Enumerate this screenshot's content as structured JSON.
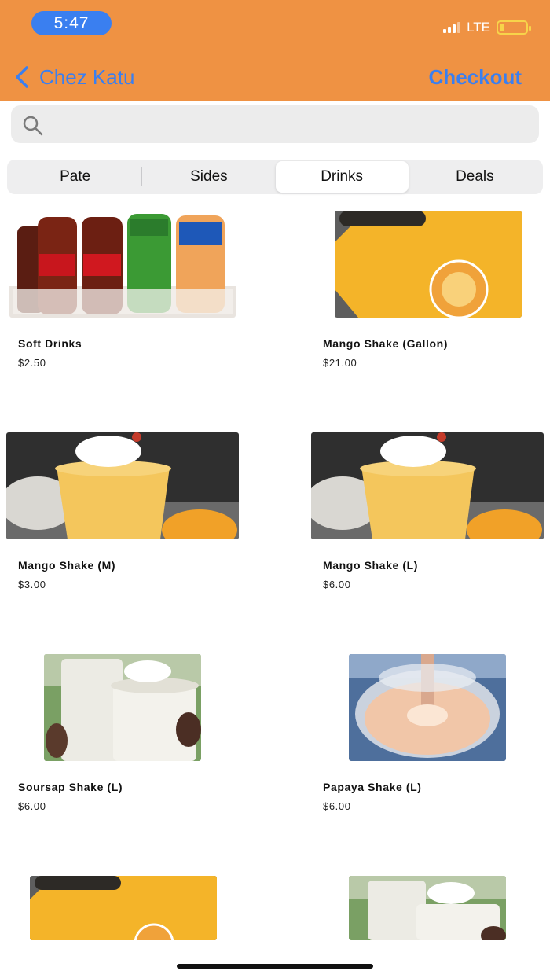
{
  "status_bar": {
    "time": "5:47",
    "network": "LTE"
  },
  "nav": {
    "back_label": "Chez Katu",
    "checkout_label": "Checkout"
  },
  "search": {
    "placeholder": ""
  },
  "tabs": [
    {
      "label": "Pate",
      "active": false
    },
    {
      "label": "Sides",
      "active": false
    },
    {
      "label": "Drinks",
      "active": true
    },
    {
      "label": "Deals",
      "active": false
    }
  ],
  "products": [
    {
      "name": "Soft Drinks",
      "price": "$2.50",
      "image": "soft-drink-bottles"
    },
    {
      "name": "Mango Shake (Gallon)",
      "price": "$21.00",
      "image": "mango-shake-gallon-bag"
    },
    {
      "name": "Mango Shake (M)",
      "price": "$3.00",
      "image": "mango-shake-cup"
    },
    {
      "name": "Mango Shake (L)",
      "price": "$6.00",
      "image": "mango-shake-cup"
    },
    {
      "name": "Soursap Shake (L)",
      "price": "$6.00",
      "image": "soursop-shake-cups"
    },
    {
      "name": "Papaya Shake (L)",
      "price": "$6.00",
      "image": "papaya-shake-cup"
    },
    {
      "name": "",
      "price": "",
      "image": "mango-shake-gallon-bag"
    },
    {
      "name": "",
      "price": "",
      "image": "soursop-shake-cups"
    }
  ],
  "colors": {
    "header": "#ef9243",
    "accent": "#3a7ff0"
  }
}
